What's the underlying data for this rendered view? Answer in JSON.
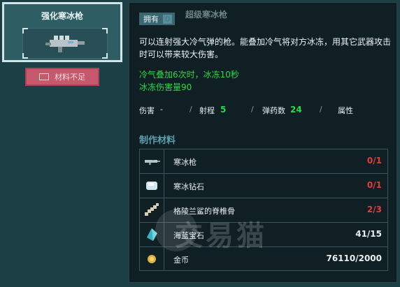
{
  "weapon_card": {
    "title": "强化寒冰枪",
    "selected": true
  },
  "insufficient_button": {
    "label": "材料不足"
  },
  "panel": {
    "title": "超级寒冰枪",
    "owned_label": "拥有",
    "owned_count": "0",
    "description": "可以连射强大冷气弹的枪。能叠加冷气将对方冰冻，用其它武器攻击时可以带来较大伤害。",
    "bonus_lines": [
      "冷气叠加6次时，冰冻10秒",
      "冰冻伤害量90"
    ],
    "stats": {
      "damage_label": "伤害",
      "damage_value": "-",
      "range_label": "射程",
      "range_value": "5",
      "ammo_label": "弹药数",
      "ammo_value": "24",
      "attr_label": "属性",
      "separator": "/"
    },
    "materials_title": "制作材料",
    "materials": [
      {
        "icon": "ice-gun-icon",
        "name": "寒冰枪",
        "count": "0/1",
        "status": "insufficient"
      },
      {
        "icon": "ice-diamond-icon",
        "name": "寒冰钻石",
        "count": "0/1",
        "status": "insufficient"
      },
      {
        "icon": "spine-bone-icon",
        "name": "格陵兰鲨的脊椎骨",
        "count": "2/3",
        "status": "insufficient"
      },
      {
        "icon": "sapphire-icon",
        "name": "海蓝宝石",
        "count": "41/15",
        "status": "sufficient"
      },
      {
        "icon": "gold-coin-icon",
        "name": "金币",
        "count": "76110/2000",
        "status": "sufficient"
      }
    ]
  },
  "watermark": "交易猫",
  "colors": {
    "insufficient": "#e63a3a",
    "sufficient": "#e8eef0",
    "accent_green": "#2bd94a",
    "section": "#5d9fb0"
  }
}
